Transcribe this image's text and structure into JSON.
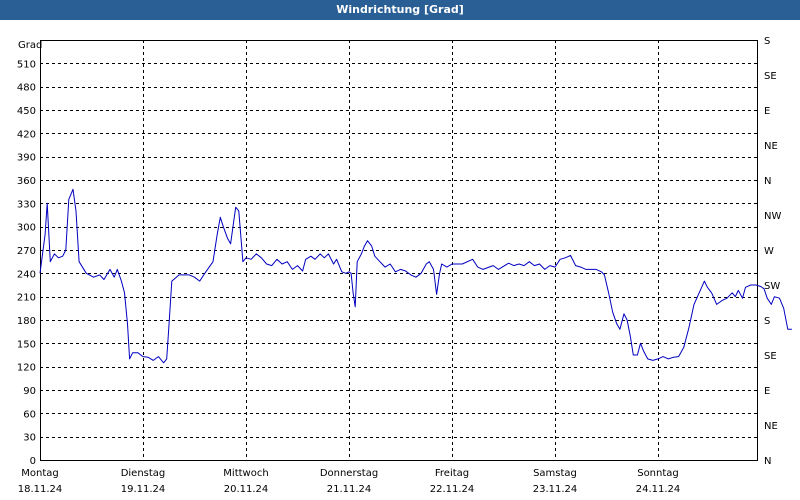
{
  "window": {
    "title": "Windrichtung [Grad]"
  },
  "chart_data": {
    "type": "line",
    "title": "Windrichtung [Grad]",
    "ylabel": "Grad",
    "ylim": [
      0,
      540
    ],
    "y_ticks": [
      0,
      30,
      60,
      90,
      120,
      150,
      180,
      210,
      240,
      270,
      300,
      330,
      360,
      390,
      420,
      450,
      480,
      510
    ],
    "right_axis_labels": [
      "N",
      "NE",
      "E",
      "SE",
      "S",
      "SW",
      "W",
      "NW",
      "N",
      "NE",
      "E",
      "SE",
      "S"
    ],
    "xlim": [
      0,
      7
    ],
    "x_ticks": [
      {
        "day": "Montag",
        "date": "18.11.24"
      },
      {
        "day": "Dienstag",
        "date": "19.11.24"
      },
      {
        "day": "Mittwoch",
        "date": "20.11.24"
      },
      {
        "day": "Donnerstag",
        "date": "21.11.24"
      },
      {
        "day": "Freitag",
        "date": "22.11.24"
      },
      {
        "day": "Samstag",
        "date": "23.11.24"
      },
      {
        "day": "Sonntag",
        "date": "24.11.24"
      }
    ],
    "grid": true,
    "series": [
      {
        "color": "#0000c0",
        "points": [
          [
            0.0,
            240
          ],
          [
            0.05,
            290
          ],
          [
            0.07,
            330
          ],
          [
            0.1,
            255
          ],
          [
            0.14,
            265
          ],
          [
            0.18,
            260
          ],
          [
            0.22,
            262
          ],
          [
            0.25,
            270
          ],
          [
            0.28,
            335
          ],
          [
            0.32,
            348
          ],
          [
            0.35,
            320
          ],
          [
            0.38,
            255
          ],
          [
            0.45,
            240
          ],
          [
            0.52,
            235
          ],
          [
            0.58,
            238
          ],
          [
            0.62,
            232
          ],
          [
            0.68,
            245
          ],
          [
            0.72,
            235
          ],
          [
            0.75,
            245
          ],
          [
            0.79,
            230
          ],
          [
            0.82,
            215
          ],
          [
            0.85,
            175
          ],
          [
            0.87,
            130
          ],
          [
            0.9,
            138
          ],
          [
            0.95,
            138
          ],
          [
            1.0,
            133
          ],
          [
            1.05,
            132
          ],
          [
            1.1,
            128
          ],
          [
            1.15,
            133
          ],
          [
            1.2,
            125
          ],
          [
            1.23,
            130
          ],
          [
            1.25,
            170
          ],
          [
            1.28,
            230
          ],
          [
            1.35,
            238
          ],
          [
            1.45,
            238
          ],
          [
            1.5,
            235
          ],
          [
            1.55,
            230
          ],
          [
            1.6,
            240
          ],
          [
            1.68,
            255
          ],
          [
            1.72,
            290
          ],
          [
            1.75,
            312
          ],
          [
            1.78,
            300
          ],
          [
            1.82,
            285
          ],
          [
            1.85,
            278
          ],
          [
            1.9,
            325
          ],
          [
            1.93,
            320
          ],
          [
            1.97,
            255
          ],
          [
            2.0,
            260
          ],
          [
            2.05,
            258
          ],
          [
            2.1,
            265
          ],
          [
            2.15,
            260
          ],
          [
            2.2,
            252
          ],
          [
            2.25,
            250
          ],
          [
            2.3,
            258
          ],
          [
            2.35,
            252
          ],
          [
            2.4,
            255
          ],
          [
            2.45,
            245
          ],
          [
            2.5,
            250
          ],
          [
            2.55,
            243
          ],
          [
            2.58,
            258
          ],
          [
            2.63,
            262
          ],
          [
            2.67,
            258
          ],
          [
            2.72,
            265
          ],
          [
            2.76,
            260
          ],
          [
            2.8,
            265
          ],
          [
            2.85,
            252
          ],
          [
            2.88,
            258
          ],
          [
            2.93,
            242
          ],
          [
            2.97,
            240
          ],
          [
            3.0,
            242
          ],
          [
            3.02,
            240
          ],
          [
            3.04,
            215
          ],
          [
            3.06,
            197
          ],
          [
            3.08,
            255
          ],
          [
            3.12,
            265
          ],
          [
            3.15,
            275
          ],
          [
            3.18,
            282
          ],
          [
            3.22,
            275
          ],
          [
            3.25,
            262
          ],
          [
            3.3,
            255
          ],
          [
            3.35,
            248
          ],
          [
            3.4,
            252
          ],
          [
            3.45,
            242
          ],
          [
            3.5,
            245
          ],
          [
            3.55,
            243
          ],
          [
            3.6,
            238
          ],
          [
            3.65,
            235
          ],
          [
            3.7,
            240
          ],
          [
            3.75,
            252
          ],
          [
            3.78,
            255
          ],
          [
            3.82,
            245
          ],
          [
            3.85,
            213
          ],
          [
            3.88,
            240
          ],
          [
            3.9,
            252
          ],
          [
            3.95,
            248
          ],
          [
            4.0,
            252
          ],
          [
            4.1,
            252
          ],
          [
            4.2,
            258
          ],
          [
            4.25,
            248
          ],
          [
            4.3,
            245
          ],
          [
            4.4,
            250
          ],
          [
            4.45,
            245
          ],
          [
            4.55,
            253
          ],
          [
            4.6,
            250
          ],
          [
            4.65,
            252
          ],
          [
            4.7,
            250
          ],
          [
            4.75,
            255
          ],
          [
            4.8,
            250
          ],
          [
            4.85,
            252
          ],
          [
            4.9,
            245
          ],
          [
            4.95,
            250
          ],
          [
            5.0,
            248
          ],
          [
            5.05,
            258
          ],
          [
            5.1,
            260
          ],
          [
            5.15,
            263
          ],
          [
            5.2,
            250
          ],
          [
            5.25,
            248
          ],
          [
            5.3,
            245
          ],
          [
            5.35,
            245
          ],
          [
            5.4,
            245
          ],
          [
            5.45,
            242
          ],
          [
            5.48,
            238
          ],
          [
            5.52,
            215
          ],
          [
            5.56,
            190
          ],
          [
            5.6,
            175
          ],
          [
            5.63,
            168
          ],
          [
            5.67,
            188
          ],
          [
            5.7,
            180
          ],
          [
            5.73,
            160
          ],
          [
            5.76,
            135
          ],
          [
            5.8,
            135
          ],
          [
            5.83,
            150
          ],
          [
            5.86,
            140
          ],
          [
            5.9,
            130
          ],
          [
            5.95,
            128
          ],
          [
            6.0,
            130
          ],
          [
            6.05,
            133
          ],
          [
            6.1,
            130
          ],
          [
            6.15,
            132
          ],
          [
            6.2,
            133
          ],
          [
            6.25,
            145
          ],
          [
            6.3,
            170
          ],
          [
            6.35,
            200
          ],
          [
            6.4,
            215
          ],
          [
            6.45,
            230
          ],
          [
            6.48,
            222
          ],
          [
            6.52,
            215
          ],
          [
            6.57,
            200
          ],
          [
            6.62,
            205
          ],
          [
            6.67,
            208
          ],
          [
            6.72,
            215
          ],
          [
            6.75,
            210
          ],
          [
            6.78,
            218
          ],
          [
            6.82,
            208
          ],
          [
            6.85,
            222
          ],
          [
            6.9,
            225
          ],
          [
            6.95,
            225
          ],
          [
            7.0,
            223
          ],
          [
            7.03,
            220
          ],
          [
            7.06,
            208
          ],
          [
            7.1,
            200
          ],
          [
            7.13,
            210
          ],
          [
            7.18,
            208
          ],
          [
            7.22,
            195
          ],
          [
            7.26,
            168
          ],
          [
            7.3,
            168
          ]
        ]
      }
    ]
  }
}
